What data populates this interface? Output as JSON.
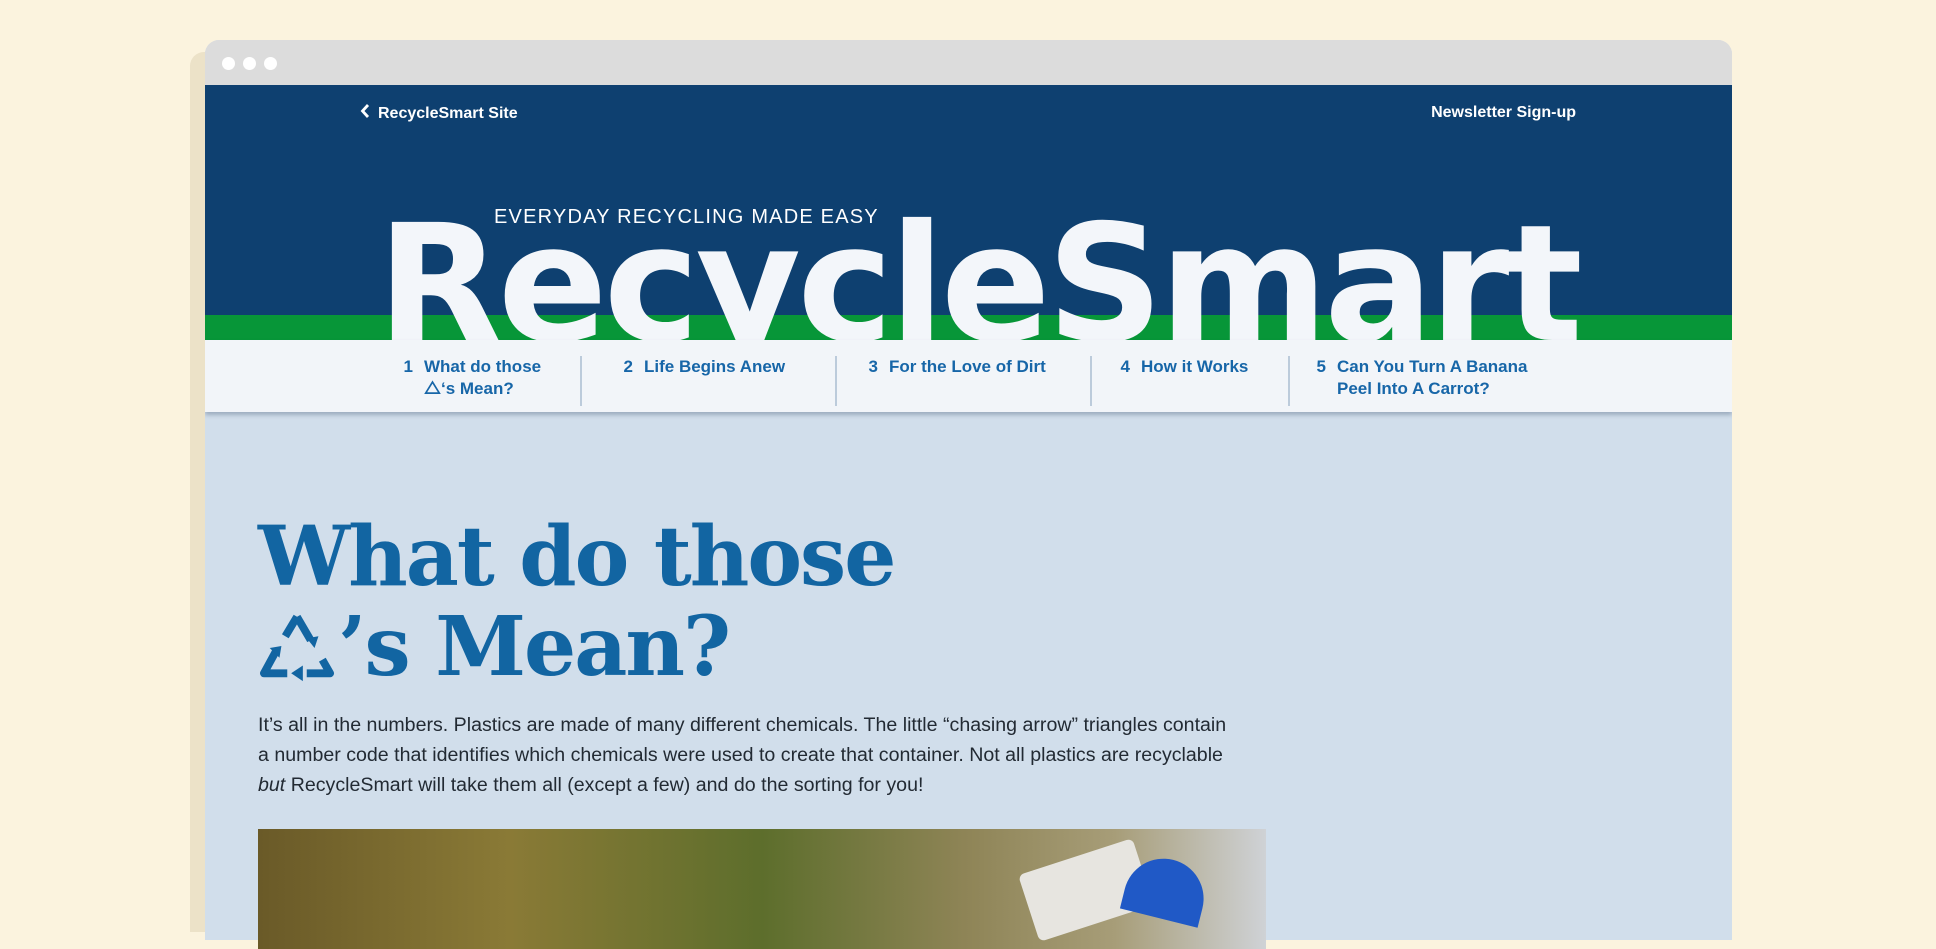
{
  "window": {
    "controls": [
      "close",
      "minimize",
      "zoom"
    ]
  },
  "header": {
    "back_link_label": "RecycleSmart Site",
    "back_icon": "chevron-left-icon",
    "newsletter_label": "Newsletter Sign-up",
    "tagline": "EVERYDAY RECYCLING MADE EASY",
    "brand": "RecycleSmart"
  },
  "nav": {
    "items": [
      {
        "num": "1",
        "line1": "What do those",
        "line2": "‘s Mean?",
        "icon": "recycle-icon"
      },
      {
        "num": "2",
        "line1": "Life Begins Anew"
      },
      {
        "num": "3",
        "line1": "For the Love of Dirt"
      },
      {
        "num": "4",
        "line1": "How it Works"
      },
      {
        "num": "5",
        "line1": "Can You Turn A Banana",
        "line2": "Peel Into A Carrot?"
      }
    ]
  },
  "article": {
    "title_line1": "What do those",
    "title_line2": "’s Mean?",
    "title_icon": "recycle-icon",
    "body_part1": "It’s all in the numbers. Plastics are made of many different chemicals. The little “chasing arrow” triangles contain a number code that identifies which chemicals were used to create that container. Not all plastics are recyclable ",
    "body_emphasis": "but",
    "body_part2": " RecycleSmart will take them all (except a few) and do the sorting for you!"
  },
  "colors": {
    "page_background": "#fbf3de",
    "header_navy": "#0e4070",
    "brand_green": "#079638",
    "link_blue": "#1766a8",
    "content_background": "#d1deeb"
  }
}
